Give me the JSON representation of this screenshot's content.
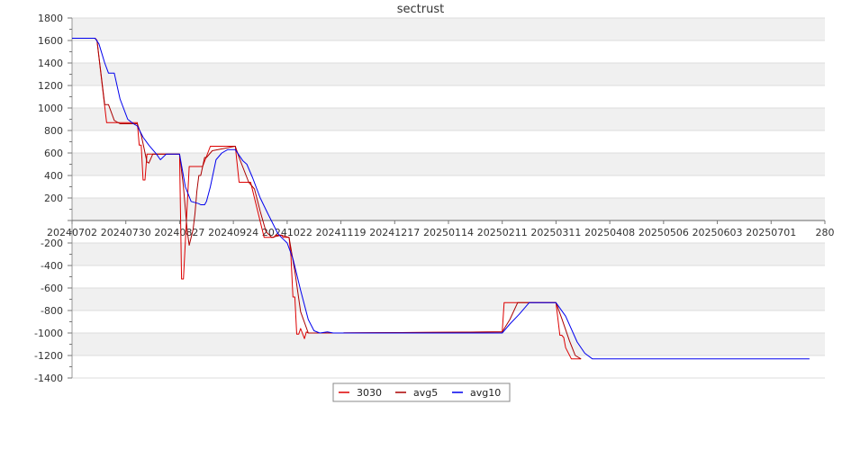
{
  "chart_data": {
    "type": "line",
    "title": "sectrust",
    "xlabel": "",
    "ylabel": "",
    "ylim": [
      -1400,
      1800
    ],
    "yticks": [
      1800,
      1600,
      1400,
      1200,
      1000,
      800,
      600,
      400,
      200,
      -200,
      -400,
      -600,
      -800,
      -1000,
      -1200,
      -1400
    ],
    "xlim": [
      "2024-07-02",
      "2025-07-29"
    ],
    "xticks": [
      {
        "date": "2024-07-02",
        "label": "20240702"
      },
      {
        "date": "2024-07-30",
        "label": "20240730"
      },
      {
        "date": "2024-08-27",
        "label": "20240827"
      },
      {
        "date": "2024-09-24",
        "label": "20240924"
      },
      {
        "date": "2024-10-22",
        "label": "20241022"
      },
      {
        "date": "2024-11-19",
        "label": "20241119"
      },
      {
        "date": "2024-12-17",
        "label": "20241217"
      },
      {
        "date": "2025-01-14",
        "label": "20250114"
      },
      {
        "date": "2025-02-11",
        "label": "20250211"
      },
      {
        "date": "2025-03-11",
        "label": "20250311"
      },
      {
        "date": "2025-04-08",
        "label": "20250408"
      },
      {
        "date": "2025-05-06",
        "label": "20250506"
      },
      {
        "date": "2025-06-03",
        "label": "20250603"
      },
      {
        "date": "2025-07-01",
        "label": "20250701"
      },
      {
        "date": "2025-07-29",
        "label": "280"
      }
    ],
    "grid": true,
    "legend_position": "bottom-center",
    "series": [
      {
        "name": "3030",
        "color": "#dd0000",
        "points": [
          [
            "2024-07-02",
            1620
          ],
          [
            "2024-07-14",
            1620
          ],
          [
            "2024-07-15",
            1600
          ],
          [
            "2024-07-20",
            870
          ],
          [
            "2024-07-29",
            870
          ],
          [
            "2024-08-05",
            870
          ],
          [
            "2024-08-06",
            670
          ],
          [
            "2024-08-07",
            670
          ],
          [
            "2024-08-08",
            360
          ],
          [
            "2024-08-09",
            360
          ],
          [
            "2024-08-10",
            590
          ],
          [
            "2024-08-24",
            590
          ],
          [
            "2024-08-27",
            590
          ],
          [
            "2024-08-28",
            -520
          ],
          [
            "2024-08-29",
            -520
          ],
          [
            "2024-09-01",
            480
          ],
          [
            "2024-09-08",
            480
          ],
          [
            "2024-09-12",
            660
          ],
          [
            "2024-09-25",
            660
          ],
          [
            "2024-09-27",
            340
          ],
          [
            "2024-10-03",
            340
          ],
          [
            "2024-10-10",
            -150
          ],
          [
            "2024-10-15",
            -150
          ],
          [
            "2024-10-16",
            -130
          ],
          [
            "2024-10-19",
            -130
          ],
          [
            "2024-10-20",
            -150
          ],
          [
            "2024-10-23",
            -150
          ],
          [
            "2024-10-24",
            -320
          ],
          [
            "2024-10-25",
            -680
          ],
          [
            "2024-10-26",
            -680
          ],
          [
            "2024-10-27",
            -1010
          ],
          [
            "2024-10-28",
            -1010
          ],
          [
            "2024-10-29",
            -960
          ],
          [
            "2024-10-31",
            -1050
          ],
          [
            "2024-11-01",
            -990
          ],
          [
            "2024-11-02",
            -1000
          ],
          [
            "2024-11-15",
            -1000
          ],
          [
            "2025-02-07",
            -990
          ],
          [
            "2025-02-11",
            -990
          ],
          [
            "2025-02-12",
            -730
          ],
          [
            "2025-03-11",
            -730
          ],
          [
            "2025-03-13",
            -1020
          ],
          [
            "2025-03-14",
            -1020
          ],
          [
            "2025-03-15",
            -1040
          ],
          [
            "2025-03-16",
            -1130
          ],
          [
            "2025-03-19",
            -1230
          ],
          [
            "2025-03-24",
            -1230
          ]
        ]
      },
      {
        "name": "avg5",
        "color": "#aa0000",
        "points": [
          [
            "2024-07-02",
            1620
          ],
          [
            "2024-07-14",
            1620
          ],
          [
            "2024-07-15",
            1600
          ],
          [
            "2024-07-19",
            1030
          ],
          [
            "2024-07-21",
            1030
          ],
          [
            "2024-07-24",
            890
          ],
          [
            "2024-07-27",
            860
          ],
          [
            "2024-07-31",
            860
          ],
          [
            "2024-08-05",
            860
          ],
          [
            "2024-08-07",
            760
          ],
          [
            "2024-08-10",
            520
          ],
          [
            "2024-08-11",
            510
          ],
          [
            "2024-08-13",
            590
          ],
          [
            "2024-08-27",
            590
          ],
          [
            "2024-08-29",
            300
          ],
          [
            "2024-08-31",
            -100
          ],
          [
            "2024-09-01",
            -220
          ],
          [
            "2024-09-03",
            -80
          ],
          [
            "2024-09-04",
            60
          ],
          [
            "2024-09-05",
            260
          ],
          [
            "2024-09-06",
            400
          ],
          [
            "2024-09-07",
            400
          ],
          [
            "2024-09-09",
            560
          ],
          [
            "2024-09-10",
            560
          ],
          [
            "2024-09-13",
            620
          ],
          [
            "2024-09-25",
            660
          ],
          [
            "2024-09-27",
            560
          ],
          [
            "2024-10-02",
            340
          ],
          [
            "2024-10-05",
            280
          ],
          [
            "2024-10-08",
            80
          ],
          [
            "2024-10-11",
            -100
          ],
          [
            "2024-10-14",
            -150
          ],
          [
            "2024-10-19",
            -130
          ],
          [
            "2024-10-23",
            -150
          ],
          [
            "2024-10-26",
            -450
          ],
          [
            "2024-10-29",
            -810
          ],
          [
            "2024-11-02",
            -1000
          ],
          [
            "2024-11-15",
            -1000
          ],
          [
            "2025-02-11",
            -990
          ],
          [
            "2025-02-15",
            -880
          ],
          [
            "2025-02-19",
            -730
          ],
          [
            "2025-03-11",
            -730
          ],
          [
            "2025-03-14",
            -870
          ],
          [
            "2025-03-18",
            -1070
          ],
          [
            "2025-03-21",
            -1200
          ],
          [
            "2025-03-24",
            -1230
          ]
        ]
      },
      {
        "name": "avg10",
        "color": "#0000ee",
        "points": [
          [
            "2024-07-02",
            1620
          ],
          [
            "2024-07-14",
            1620
          ],
          [
            "2024-07-16",
            1570
          ],
          [
            "2024-07-19",
            1400
          ],
          [
            "2024-07-21",
            1310
          ],
          [
            "2024-07-24",
            1310
          ],
          [
            "2024-07-27",
            1080
          ],
          [
            "2024-07-31",
            900
          ],
          [
            "2024-08-03",
            860
          ],
          [
            "2024-08-05",
            840
          ],
          [
            "2024-08-08",
            740
          ],
          [
            "2024-08-11",
            670
          ],
          [
            "2024-08-15",
            590
          ],
          [
            "2024-08-17",
            540
          ],
          [
            "2024-08-20",
            590
          ],
          [
            "2024-08-27",
            590
          ],
          [
            "2024-08-30",
            300
          ],
          [
            "2024-09-02",
            170
          ],
          [
            "2024-09-06",
            150
          ],
          [
            "2024-09-07",
            140
          ],
          [
            "2024-09-09",
            140
          ],
          [
            "2024-09-10",
            170
          ],
          [
            "2024-09-12",
            300
          ],
          [
            "2024-09-15",
            540
          ],
          [
            "2024-09-18",
            600
          ],
          [
            "2024-09-21",
            630
          ],
          [
            "2024-09-25",
            630
          ],
          [
            "2024-09-29",
            530
          ],
          [
            "2024-10-01",
            500
          ],
          [
            "2024-10-04",
            380
          ],
          [
            "2024-10-08",
            200
          ],
          [
            "2024-10-12",
            60
          ],
          [
            "2024-10-17",
            -110
          ],
          [
            "2024-10-19",
            -150
          ],
          [
            "2024-10-22",
            -200
          ],
          [
            "2024-10-25",
            -340
          ],
          [
            "2024-10-29",
            -620
          ],
          [
            "2024-11-02",
            -880
          ],
          [
            "2024-11-05",
            -980
          ],
          [
            "2024-11-08",
            -1000
          ],
          [
            "2024-11-12",
            -990
          ],
          [
            "2024-11-15",
            -1000
          ],
          [
            "2025-02-11",
            -1000
          ],
          [
            "2025-02-15",
            -920
          ],
          [
            "2025-02-20",
            -830
          ],
          [
            "2025-02-25",
            -730
          ],
          [
            "2025-03-11",
            -730
          ],
          [
            "2025-03-16",
            -850
          ],
          [
            "2025-03-22",
            -1080
          ],
          [
            "2025-03-26",
            -1180
          ],
          [
            "2025-03-30",
            -1230
          ],
          [
            "2025-07-21",
            -1230
          ]
        ]
      }
    ]
  }
}
